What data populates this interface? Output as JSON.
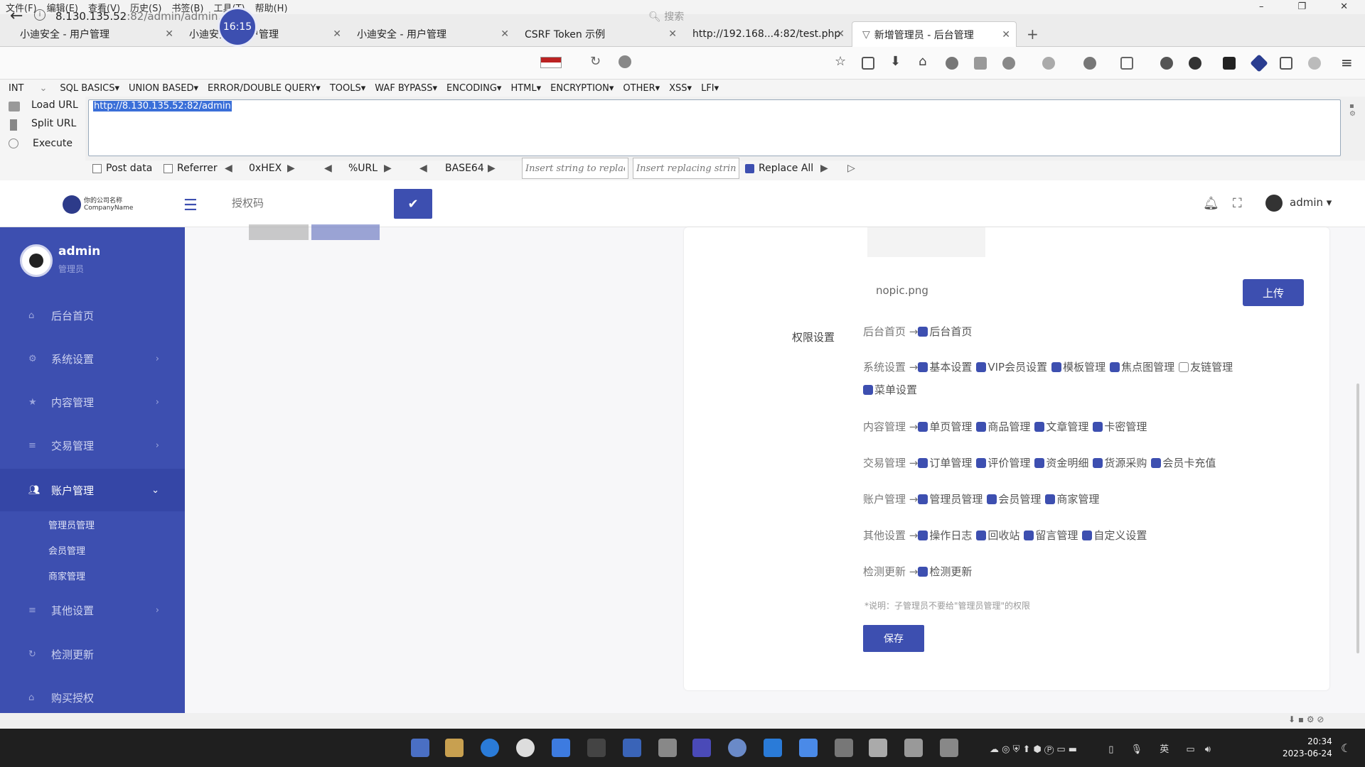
{
  "menubar": [
    "文件(F)",
    "编辑(E)",
    "查看(V)",
    "历史(S)",
    "书签(B)",
    "工具(T)",
    "帮助(H)"
  ],
  "clock_badge": "16:15",
  "tabs": [
    {
      "label": "小迪安全 - 用户管理"
    },
    {
      "label": "小迪安全 - 用户管理"
    },
    {
      "label": "小迪安全 - 用户管理"
    },
    {
      "label": "CSRF Token 示例"
    },
    {
      "label": "http://192.168...4:82/test.php"
    },
    {
      "label": "新增管理员 - 后台管理"
    }
  ],
  "url": {
    "host": "8.130.135.52",
    "rest": ":82/admin/admin.php"
  },
  "search_placeholder": "搜索",
  "hackbar": {
    "type": "INT",
    "menus": [
      "SQL BASICS▾",
      "UNION BASED▾",
      "ERROR/DOUBLE QUERY▾",
      "TOOLS▾",
      "WAF BYPASS▾",
      "ENCODING▾",
      "HTML▾",
      "ENCRYPTION▾",
      "OTHER▾",
      "XSS▾",
      "LFI▾"
    ],
    "load": "Load URL",
    "split": "Split URL",
    "execute": "Execute",
    "input": "http://8.130.135.52:82/admin",
    "post": "Post data",
    "referrer": "Referrer",
    "hex": "0xHEX",
    "url": "%URL",
    "b64": "BASE64",
    "replace_ph": "Insert string to replace",
    "replacing_ph": "Insert replacing string",
    "replace_all": "Replace All"
  },
  "header": {
    "auth_placeholder": "授权码",
    "user": "admin ▾",
    "logo_line1": "你的公司名称",
    "logo_line2": "CompanyName"
  },
  "sidebar": {
    "name": "admin",
    "role": "管理员",
    "items": [
      "后台首页",
      "系统设置",
      "内容管理",
      "交易管理",
      "账户管理",
      "其他设置",
      "检测更新",
      "购买授权"
    ],
    "sub": [
      "管理员管理",
      "会员管理",
      "商家管理"
    ]
  },
  "main": {
    "nopic": "nopic.png",
    "upload": "上传",
    "perm_label": "权限设置",
    "rows": [
      {
        "label": "后台首页 →",
        "items": [
          {
            "t": "后台首页",
            "on": true
          }
        ]
      },
      {
        "label": "系统设置 →",
        "items": [
          {
            "t": "基本设置",
            "on": true
          },
          {
            "t": "VIP会员设置",
            "on": true
          },
          {
            "t": "模板管理",
            "on": true
          },
          {
            "t": "焦点图管理",
            "on": true
          },
          {
            "t": "友链管理",
            "on": false
          }
        ]
      },
      {
        "label": "",
        "items": [
          {
            "t": "菜单设置",
            "on": true
          }
        ]
      },
      {
        "label": "内容管理 →",
        "items": [
          {
            "t": "单页管理",
            "on": true
          },
          {
            "t": "商品管理",
            "on": true
          },
          {
            "t": "文章管理",
            "on": true
          },
          {
            "t": "卡密管理",
            "on": true
          }
        ]
      },
      {
        "label": "交易管理 →",
        "items": [
          {
            "t": "订单管理",
            "on": true
          },
          {
            "t": "评价管理",
            "on": true
          },
          {
            "t": "资金明细",
            "on": true
          },
          {
            "t": "货源采购",
            "on": true
          },
          {
            "t": "会员卡充值",
            "on": true
          }
        ]
      },
      {
        "label": "账户管理 →",
        "items": [
          {
            "t": "管理员管理",
            "on": true
          },
          {
            "t": "会员管理",
            "on": true
          },
          {
            "t": "商家管理",
            "on": true
          }
        ]
      },
      {
        "label": "其他设置 →",
        "items": [
          {
            "t": "操作日志",
            "on": true
          },
          {
            "t": "回收站",
            "on": true
          },
          {
            "t": "留言管理",
            "on": true
          },
          {
            "t": "自定义设置",
            "on": true
          }
        ]
      },
      {
        "label": "检测更新 →",
        "items": [
          {
            "t": "检测更新",
            "on": true
          }
        ]
      }
    ],
    "note": "*说明：子管理员不要给\"管理员管理\"的权限",
    "save": "保存"
  },
  "taskbar": {
    "time": "20:34",
    "date": "2023-06-24",
    "ime": "英"
  }
}
